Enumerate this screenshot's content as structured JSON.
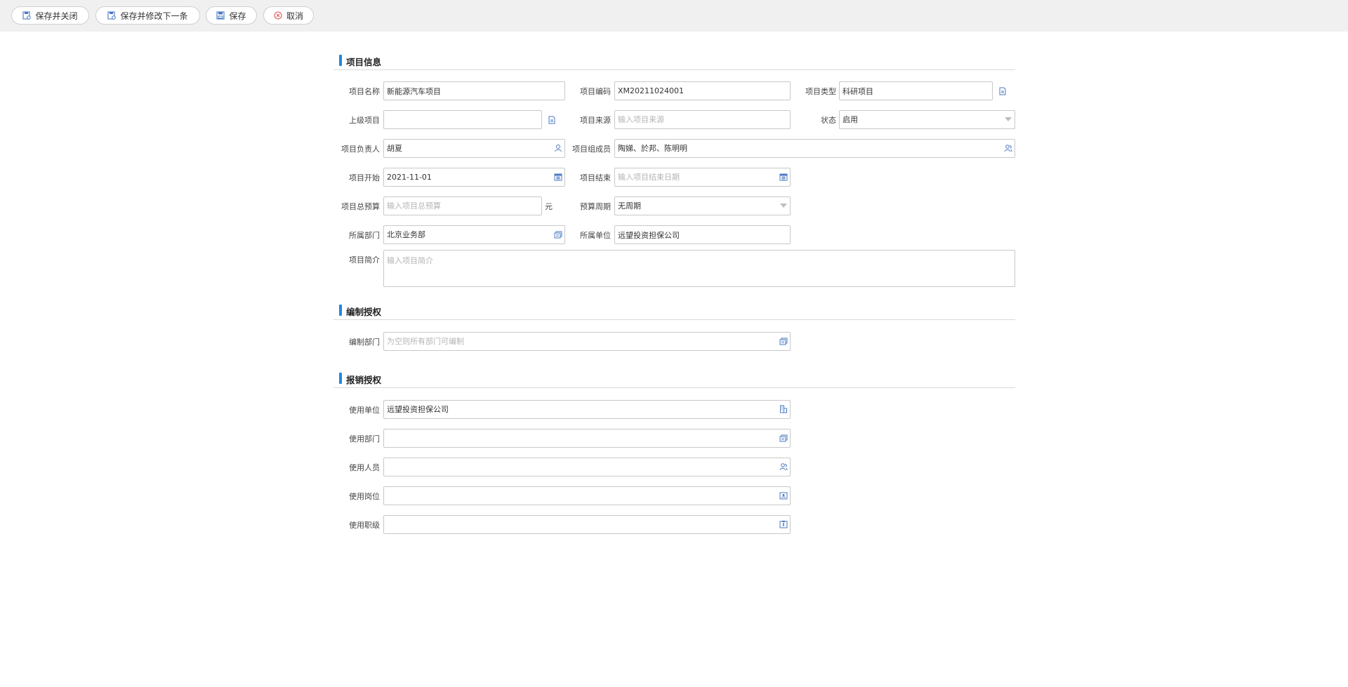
{
  "toolbar": {
    "save_close": "保存并关闭",
    "save_next": "保存并修改下一条",
    "save": "保存",
    "cancel": "取消"
  },
  "sections": {
    "project_info": "项目信息",
    "edit_auth": "编制授权",
    "reimburse_auth": "报销授权"
  },
  "project": {
    "name": {
      "label": "项目名称",
      "value": "新能源汽车项目"
    },
    "code": {
      "label": "项目编码",
      "value": "XM20211024001"
    },
    "type": {
      "label": "项目类型",
      "value": "科研项目"
    },
    "parent": {
      "label": "上级项目",
      "value": ""
    },
    "source": {
      "label": "项目来源",
      "placeholder": "输入项目来源"
    },
    "status": {
      "label": "状态",
      "value": "启用"
    },
    "leader": {
      "label": "项目负责人",
      "value": "胡夏"
    },
    "members": {
      "label": "项目组成员",
      "value": "陶娣、於邦、陈明明"
    },
    "start": {
      "label": "项目开始",
      "value": "2021-11-01"
    },
    "end": {
      "label": "项目结束",
      "placeholder": "输入项目结束日期"
    },
    "budget": {
      "label": "项目总预算",
      "placeholder": "输入项目总预算",
      "unit": "元"
    },
    "budget_period": {
      "label": "预算周期",
      "value": "无周期"
    },
    "department": {
      "label": "所属部门",
      "value": "北京业务部"
    },
    "unit": {
      "label": "所属单位",
      "value": "远望投资担保公司"
    },
    "intro": {
      "label": "项目简介",
      "placeholder": "输入项目简介"
    }
  },
  "edit_auth": {
    "dept": {
      "label": "编制部门",
      "placeholder": "为空则所有部门可编制"
    }
  },
  "reimburse": {
    "unit": {
      "label": "使用单位",
      "value": "远望投资担保公司"
    },
    "dept": {
      "label": "使用部门",
      "value": ""
    },
    "person": {
      "label": "使用人员",
      "value": ""
    },
    "post": {
      "label": "使用岗位",
      "value": ""
    },
    "rank": {
      "label": "使用职级",
      "value": ""
    }
  },
  "colors": {
    "accent": "#1e88e5",
    "icon": "#4a78c2",
    "cancel_icon": "#e05555"
  }
}
